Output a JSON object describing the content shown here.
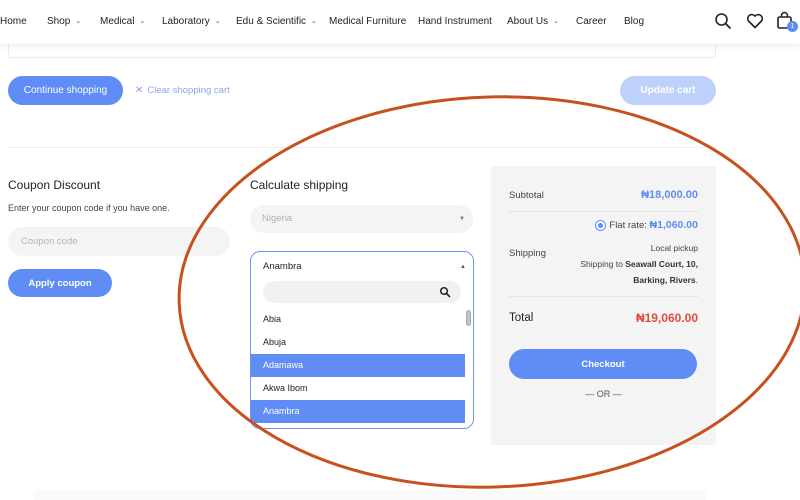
{
  "nav": {
    "items": [
      {
        "label": "Home",
        "has_chevron": false
      },
      {
        "label": "Shop",
        "has_chevron": true
      },
      {
        "label": "Medical",
        "has_chevron": true
      },
      {
        "label": "Laboratory",
        "has_chevron": true
      },
      {
        "label": "Edu & Scientific",
        "has_chevron": true
      },
      {
        "label": "Medical Furniture",
        "has_chevron": false
      },
      {
        "label": "Hand Instrument",
        "has_chevron": false
      },
      {
        "label": "About Us",
        "has_chevron": true
      },
      {
        "label": "Career",
        "has_chevron": false
      },
      {
        "label": "Blog",
        "has_chevron": false
      }
    ],
    "icons": [
      "search-icon",
      "heart-icon",
      "bag-icon"
    ],
    "cart_count": "1"
  },
  "cart_actions": {
    "continue_label": "Continue shopping",
    "clear_label": "Clear shopping cart",
    "update_label": "Update cart"
  },
  "coupon": {
    "title": "Coupon Discount",
    "description": "Enter your coupon code if you have one.",
    "placeholder": "Coupon code",
    "apply_label": "Apply coupon"
  },
  "shipping": {
    "title": "Calculate shipping",
    "country_placeholder": "Nigeria",
    "state_selected": "Anambra",
    "options": [
      {
        "label": "Abia",
        "highlighted": false
      },
      {
        "label": "Abuja",
        "highlighted": false
      },
      {
        "label": "Adamawa",
        "highlighted": true
      },
      {
        "label": "Akwa Ibom",
        "highlighted": false
      },
      {
        "label": "Anambra",
        "highlighted": true
      }
    ]
  },
  "totals": {
    "subtotal_label": "Subtotal",
    "subtotal_value": "₦18,000.00",
    "shipping_label": "Shipping",
    "flat_rate_text": "Flat rate:",
    "flat_rate_value": "₦1,060.00",
    "local_pickup": "Local pickup",
    "shipping_to_text": "Shipping to",
    "shipping_address_line1": "Seawall Court, 10,",
    "shipping_address_line2": "Barking, Rivers",
    "total_label": "Total",
    "total_value": "₦19,060.00",
    "checkout_label": "Checkout",
    "or_text": "— OR —"
  },
  "colors": {
    "accent": "#5f8df5",
    "accent_light": "#bed1fb",
    "total_red": "#e34a3b",
    "annotation": "#c8501f"
  }
}
